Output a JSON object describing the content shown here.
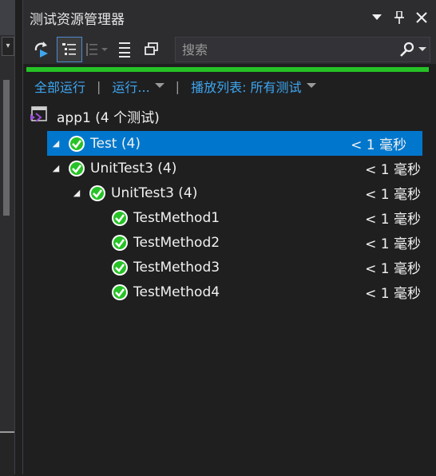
{
  "window": {
    "title": "测试资源管理器"
  },
  "search": {
    "placeholder": "搜索"
  },
  "actions": {
    "run_all": "全部运行",
    "run": "运行...",
    "playlist": "播放列表: 所有测试"
  },
  "project": {
    "label": "app1 (4 个测试)"
  },
  "tree": [
    {
      "name": "Test (4)",
      "duration": "< 1 毫秒",
      "level": 0,
      "expander": "◢",
      "selected": true
    },
    {
      "name": "UnitTest3 (4)",
      "duration": "< 1 毫秒",
      "level": 1,
      "expander": "◢",
      "selected": false
    },
    {
      "name": "UnitTest3 (4)",
      "duration": "< 1 毫秒",
      "level": 2,
      "expander": "◢",
      "selected": false
    },
    {
      "name": "TestMethod1",
      "duration": "< 1 毫秒",
      "level": 3,
      "expander": "",
      "selected": false
    },
    {
      "name": "TestMethod2",
      "duration": "< 1 毫秒",
      "level": 3,
      "expander": "",
      "selected": false
    },
    {
      "name": "TestMethod3",
      "duration": "< 1 毫秒",
      "level": 3,
      "expander": "",
      "selected": false
    },
    {
      "name": "TestMethod4",
      "duration": "< 1 毫秒",
      "level": 3,
      "expander": "",
      "selected": false
    }
  ],
  "colors": {
    "accent": "#0077cc",
    "pass": "#26c226",
    "link": "#3ea6f0"
  }
}
